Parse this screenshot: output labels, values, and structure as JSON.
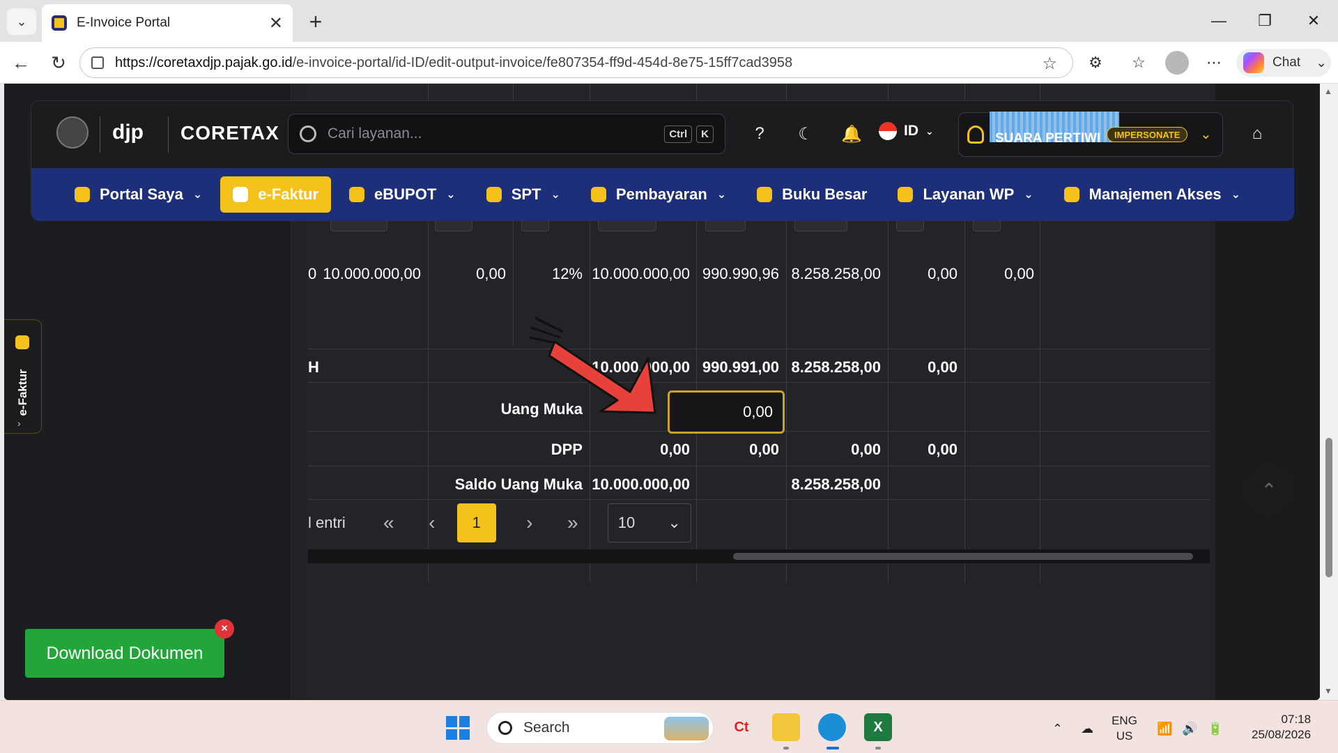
{
  "browser": {
    "tab_title": "E-Invoice Portal",
    "url_domain": "https://coretaxdjp.pajak.go.id",
    "url_path": "/e-invoice-portal/id-ID/edit-output-invoice/fe807354-ff9d-454d-8e75-15ff7cad3958",
    "chat_label": "Chat"
  },
  "header": {
    "logo_djp": "djp",
    "logo_coretax": "CORETAX",
    "search_placeholder": "Cari layanan...",
    "shortcut_ctrl": "Ctrl",
    "shortcut_k": "K",
    "language": "ID",
    "user_name": "SUARA PERTIWI",
    "impersonate_badge": "IMPERSONATE"
  },
  "nav": {
    "items": [
      {
        "label": "Portal Saya",
        "dropdown": true
      },
      {
        "label": "e-Faktur",
        "dropdown": false,
        "active": true
      },
      {
        "label": "eBUPOT",
        "dropdown": true
      },
      {
        "label": "SPT",
        "dropdown": true
      },
      {
        "label": "Pembayaran",
        "dropdown": true
      },
      {
        "label": "Buku Besar",
        "dropdown": false
      },
      {
        "label": "Layanan WP",
        "dropdown": true
      },
      {
        "label": "Manajemen Akses",
        "dropdown": true
      }
    ]
  },
  "table": {
    "row_item": {
      "c0": "0",
      "c1": "10.000.000,00",
      "c2": "0,00",
      "c3": "12%",
      "c4": "10.000.000,00",
      "c5": "990.990,96",
      "c6": "8.258.258,00",
      "c7": "0,00",
      "c8": "0,00"
    },
    "row_total": {
      "c0": "H",
      "c4": "10.000.000,00",
      "c5": "990.991,00",
      "c6": "8.258.258,00",
      "c7": "0,00"
    },
    "row_uang_muka": {
      "label": "Uang Muka",
      "input_value": "0,00"
    },
    "row_dpp": {
      "label": "DPP",
      "c4": "0,00",
      "c5": "0,00",
      "c6": "0,00",
      "c7": "0,00"
    },
    "row_saldo": {
      "label": "Saldo Uang Muka",
      "c4": "10.000.000,00",
      "c6": "8.258.258,00"
    }
  },
  "pagination": {
    "entri_label": "l entri",
    "current_page": "1",
    "page_size": "10"
  },
  "side_tab": {
    "label": "e-Faktur"
  },
  "download_button": {
    "label": "Download Dokumen"
  },
  "taskbar": {
    "search_placeholder": "Search",
    "lang_top": "ENG",
    "lang_bottom": "US",
    "time": "07:18",
    "date": "25/08/2026"
  },
  "colors": {
    "accent_yellow": "#f5c21b",
    "nav_blue": "#1e2f7a",
    "download_green": "#22a63a",
    "arrow_red": "#e8403a"
  }
}
